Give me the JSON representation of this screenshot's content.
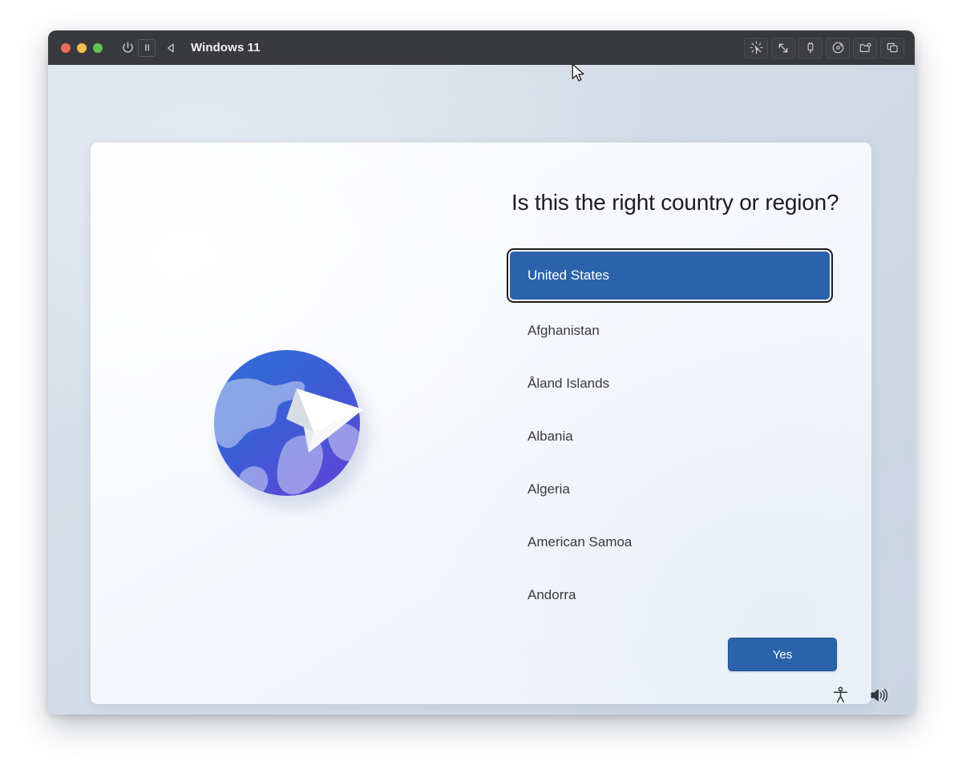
{
  "window": {
    "title": "Windows 11",
    "traffic_lights": [
      "close",
      "minimize",
      "maximize"
    ],
    "left_controls": [
      {
        "name": "power-icon",
        "label": "Power"
      },
      {
        "name": "pause-icon",
        "label": "Pause"
      },
      {
        "name": "back-icon",
        "label": "Back"
      }
    ],
    "right_controls": [
      {
        "name": "click-burst-icon",
        "label": "Input Capture"
      },
      {
        "name": "resize-diagonal-icon",
        "label": "Resize Display"
      },
      {
        "name": "usb-icon",
        "label": "USB Devices"
      },
      {
        "name": "disc-icon",
        "label": "CD/DVD"
      },
      {
        "name": "shared-folder-icon",
        "label": "Shared Folders"
      },
      {
        "name": "snapshots-icon",
        "label": "Snapshots"
      }
    ]
  },
  "oobe": {
    "heading": "Is this the right country or region?",
    "illustration": {
      "name": "globe-paper-plane-illustration",
      "globe_top_color": "#2f6fd6",
      "globe_bottom_color": "#5d44d6",
      "continent_color": "#5b90e8",
      "plane_color": "#ffffff"
    },
    "countries": [
      {
        "label": "United States",
        "selected": true
      },
      {
        "label": "Afghanistan",
        "selected": false
      },
      {
        "label": "Åland Islands",
        "selected": false
      },
      {
        "label": "Albania",
        "selected": false
      },
      {
        "label": "Algeria",
        "selected": false
      },
      {
        "label": "American Samoa",
        "selected": false
      },
      {
        "label": "Andorra",
        "selected": false
      }
    ],
    "confirm_button": "Yes",
    "accent_color": "#2b63ab",
    "bottom_icons": [
      {
        "name": "accessibility-icon",
        "label": "Accessibility"
      },
      {
        "name": "volume-icon",
        "label": "Volume"
      }
    ]
  }
}
